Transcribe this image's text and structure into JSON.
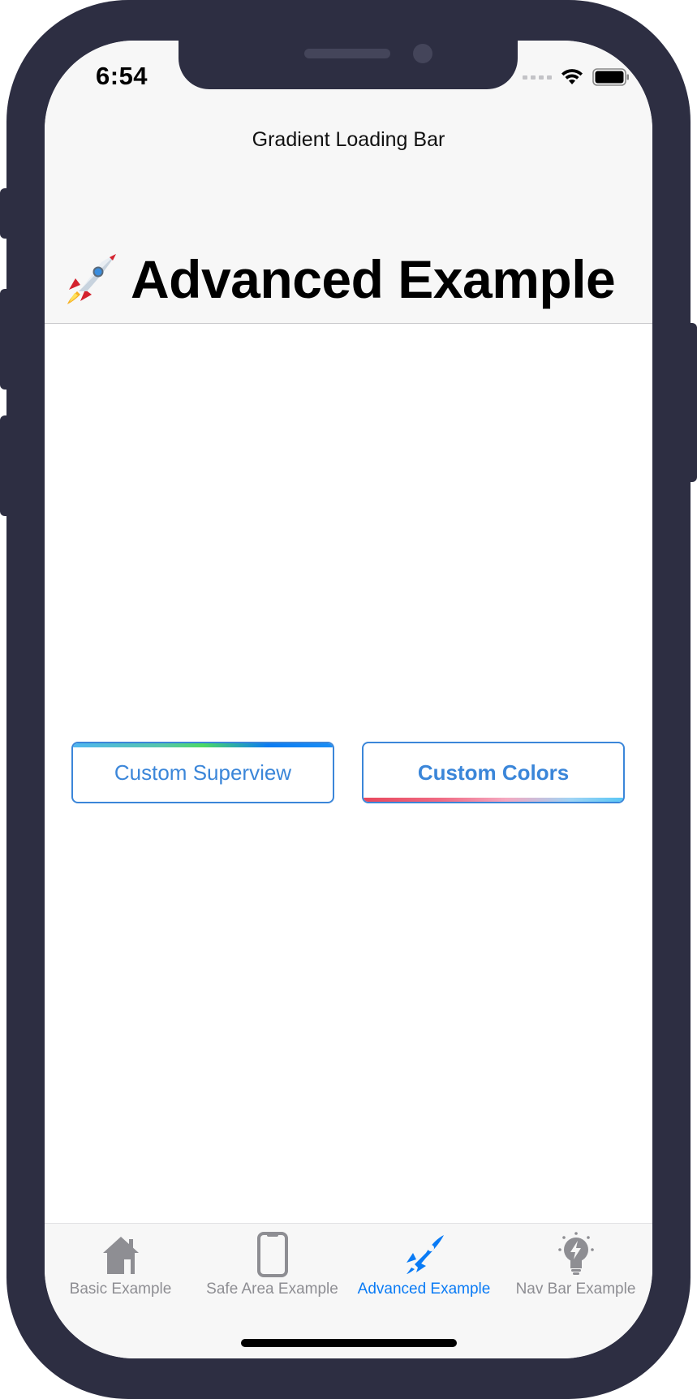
{
  "status_bar": {
    "time": "6:54"
  },
  "nav": {
    "title": "Gradient Loading Bar",
    "large_title": "Advanced Example",
    "large_title_emoji": "rocket-icon"
  },
  "content": {
    "buttons": [
      {
        "label": "Custom Superview",
        "gradient_colors": [
          "#4fb6f0",
          "#4cd964",
          "#0b7bf2"
        ]
      },
      {
        "label": "Custom Colors",
        "gradient_colors": [
          "#e8475c",
          "#f5a8c0",
          "#59c6f5"
        ]
      }
    ]
  },
  "tabbar": {
    "items": [
      {
        "label": "Basic Example",
        "icon": "house-icon",
        "active": false
      },
      {
        "label": "Safe Area Example",
        "icon": "iphone-icon",
        "active": false
      },
      {
        "label": "Advanced Example",
        "icon": "rocket-icon",
        "active": true
      },
      {
        "label": "Nav Bar Example",
        "icon": "lightbulb-icon",
        "active": false
      }
    ]
  },
  "colors": {
    "accent": "#0a7bf5",
    "button_tint": "#3b86d9",
    "tab_inactive": "#8e8e93",
    "device_frame": "#2d2e42"
  }
}
